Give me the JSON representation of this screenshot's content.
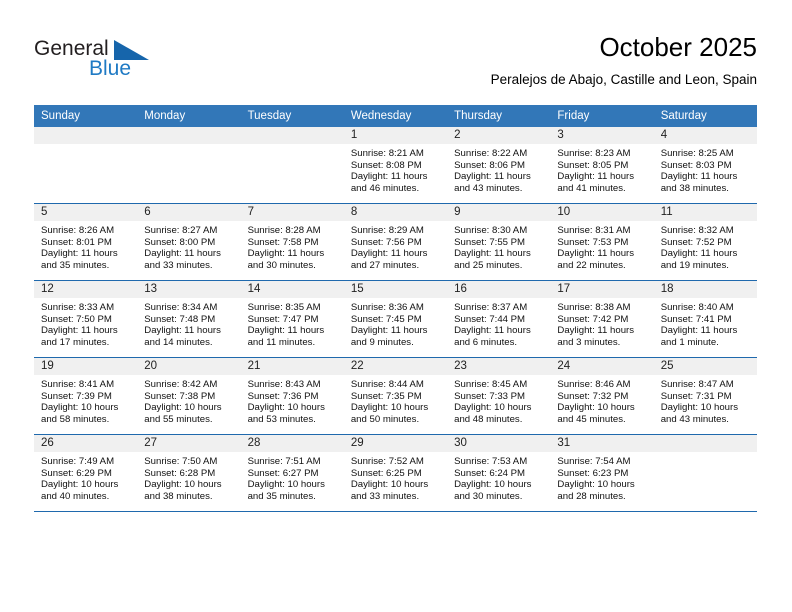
{
  "brand": {
    "name_part1": "General",
    "name_part2": "Blue"
  },
  "header": {
    "title": "October 2025",
    "subtitle": "Peralejos de Abajo, Castille and Leon, Spain"
  },
  "colors": {
    "header_blue": "#3277b8",
    "row_border_blue": "#1f69ad",
    "daynum_band": "#f0f0f0",
    "logo_blue": "#1f7ac4",
    "logo_triangle": "#1665ab"
  },
  "weekdays": [
    "Sunday",
    "Monday",
    "Tuesday",
    "Wednesday",
    "Thursday",
    "Friday",
    "Saturday"
  ],
  "weeks": [
    [
      {
        "day": "",
        "sunrise": "",
        "sunset": "",
        "daylight1": "",
        "daylight2": ""
      },
      {
        "day": "",
        "sunrise": "",
        "sunset": "",
        "daylight1": "",
        "daylight2": ""
      },
      {
        "day": "",
        "sunrise": "",
        "sunset": "",
        "daylight1": "",
        "daylight2": ""
      },
      {
        "day": "1",
        "sunrise": "Sunrise: 8:21 AM",
        "sunset": "Sunset: 8:08 PM",
        "daylight1": "Daylight: 11 hours",
        "daylight2": "and 46 minutes."
      },
      {
        "day": "2",
        "sunrise": "Sunrise: 8:22 AM",
        "sunset": "Sunset: 8:06 PM",
        "daylight1": "Daylight: 11 hours",
        "daylight2": "and 43 minutes."
      },
      {
        "day": "3",
        "sunrise": "Sunrise: 8:23 AM",
        "sunset": "Sunset: 8:05 PM",
        "daylight1": "Daylight: 11 hours",
        "daylight2": "and 41 minutes."
      },
      {
        "day": "4",
        "sunrise": "Sunrise: 8:25 AM",
        "sunset": "Sunset: 8:03 PM",
        "daylight1": "Daylight: 11 hours",
        "daylight2": "and 38 minutes."
      }
    ],
    [
      {
        "day": "5",
        "sunrise": "Sunrise: 8:26 AM",
        "sunset": "Sunset: 8:01 PM",
        "daylight1": "Daylight: 11 hours",
        "daylight2": "and 35 minutes."
      },
      {
        "day": "6",
        "sunrise": "Sunrise: 8:27 AM",
        "sunset": "Sunset: 8:00 PM",
        "daylight1": "Daylight: 11 hours",
        "daylight2": "and 33 minutes."
      },
      {
        "day": "7",
        "sunrise": "Sunrise: 8:28 AM",
        "sunset": "Sunset: 7:58 PM",
        "daylight1": "Daylight: 11 hours",
        "daylight2": "and 30 minutes."
      },
      {
        "day": "8",
        "sunrise": "Sunrise: 8:29 AM",
        "sunset": "Sunset: 7:56 PM",
        "daylight1": "Daylight: 11 hours",
        "daylight2": "and 27 minutes."
      },
      {
        "day": "9",
        "sunrise": "Sunrise: 8:30 AM",
        "sunset": "Sunset: 7:55 PM",
        "daylight1": "Daylight: 11 hours",
        "daylight2": "and 25 minutes."
      },
      {
        "day": "10",
        "sunrise": "Sunrise: 8:31 AM",
        "sunset": "Sunset: 7:53 PM",
        "daylight1": "Daylight: 11 hours",
        "daylight2": "and 22 minutes."
      },
      {
        "day": "11",
        "sunrise": "Sunrise: 8:32 AM",
        "sunset": "Sunset: 7:52 PM",
        "daylight1": "Daylight: 11 hours",
        "daylight2": "and 19 minutes."
      }
    ],
    [
      {
        "day": "12",
        "sunrise": "Sunrise: 8:33 AM",
        "sunset": "Sunset: 7:50 PM",
        "daylight1": "Daylight: 11 hours",
        "daylight2": "and 17 minutes."
      },
      {
        "day": "13",
        "sunrise": "Sunrise: 8:34 AM",
        "sunset": "Sunset: 7:48 PM",
        "daylight1": "Daylight: 11 hours",
        "daylight2": "and 14 minutes."
      },
      {
        "day": "14",
        "sunrise": "Sunrise: 8:35 AM",
        "sunset": "Sunset: 7:47 PM",
        "daylight1": "Daylight: 11 hours",
        "daylight2": "and 11 minutes."
      },
      {
        "day": "15",
        "sunrise": "Sunrise: 8:36 AM",
        "sunset": "Sunset: 7:45 PM",
        "daylight1": "Daylight: 11 hours",
        "daylight2": "and 9 minutes."
      },
      {
        "day": "16",
        "sunrise": "Sunrise: 8:37 AM",
        "sunset": "Sunset: 7:44 PM",
        "daylight1": "Daylight: 11 hours",
        "daylight2": "and 6 minutes."
      },
      {
        "day": "17",
        "sunrise": "Sunrise: 8:38 AM",
        "sunset": "Sunset: 7:42 PM",
        "daylight1": "Daylight: 11 hours",
        "daylight2": "and 3 minutes."
      },
      {
        "day": "18",
        "sunrise": "Sunrise: 8:40 AM",
        "sunset": "Sunset: 7:41 PM",
        "daylight1": "Daylight: 11 hours",
        "daylight2": "and 1 minute."
      }
    ],
    [
      {
        "day": "19",
        "sunrise": "Sunrise: 8:41 AM",
        "sunset": "Sunset: 7:39 PM",
        "daylight1": "Daylight: 10 hours",
        "daylight2": "and 58 minutes."
      },
      {
        "day": "20",
        "sunrise": "Sunrise: 8:42 AM",
        "sunset": "Sunset: 7:38 PM",
        "daylight1": "Daylight: 10 hours",
        "daylight2": "and 55 minutes."
      },
      {
        "day": "21",
        "sunrise": "Sunrise: 8:43 AM",
        "sunset": "Sunset: 7:36 PM",
        "daylight1": "Daylight: 10 hours",
        "daylight2": "and 53 minutes."
      },
      {
        "day": "22",
        "sunrise": "Sunrise: 8:44 AM",
        "sunset": "Sunset: 7:35 PM",
        "daylight1": "Daylight: 10 hours",
        "daylight2": "and 50 minutes."
      },
      {
        "day": "23",
        "sunrise": "Sunrise: 8:45 AM",
        "sunset": "Sunset: 7:33 PM",
        "daylight1": "Daylight: 10 hours",
        "daylight2": "and 48 minutes."
      },
      {
        "day": "24",
        "sunrise": "Sunrise: 8:46 AM",
        "sunset": "Sunset: 7:32 PM",
        "daylight1": "Daylight: 10 hours",
        "daylight2": "and 45 minutes."
      },
      {
        "day": "25",
        "sunrise": "Sunrise: 8:47 AM",
        "sunset": "Sunset: 7:31 PM",
        "daylight1": "Daylight: 10 hours",
        "daylight2": "and 43 minutes."
      }
    ],
    [
      {
        "day": "26",
        "sunrise": "Sunrise: 7:49 AM",
        "sunset": "Sunset: 6:29 PM",
        "daylight1": "Daylight: 10 hours",
        "daylight2": "and 40 minutes."
      },
      {
        "day": "27",
        "sunrise": "Sunrise: 7:50 AM",
        "sunset": "Sunset: 6:28 PM",
        "daylight1": "Daylight: 10 hours",
        "daylight2": "and 38 minutes."
      },
      {
        "day": "28",
        "sunrise": "Sunrise: 7:51 AM",
        "sunset": "Sunset: 6:27 PM",
        "daylight1": "Daylight: 10 hours",
        "daylight2": "and 35 minutes."
      },
      {
        "day": "29",
        "sunrise": "Sunrise: 7:52 AM",
        "sunset": "Sunset: 6:25 PM",
        "daylight1": "Daylight: 10 hours",
        "daylight2": "and 33 minutes."
      },
      {
        "day": "30",
        "sunrise": "Sunrise: 7:53 AM",
        "sunset": "Sunset: 6:24 PM",
        "daylight1": "Daylight: 10 hours",
        "daylight2": "and 30 minutes."
      },
      {
        "day": "31",
        "sunrise": "Sunrise: 7:54 AM",
        "sunset": "Sunset: 6:23 PM",
        "daylight1": "Daylight: 10 hours",
        "daylight2": "and 28 minutes."
      },
      {
        "day": "",
        "sunrise": "",
        "sunset": "",
        "daylight1": "",
        "daylight2": ""
      }
    ]
  ]
}
